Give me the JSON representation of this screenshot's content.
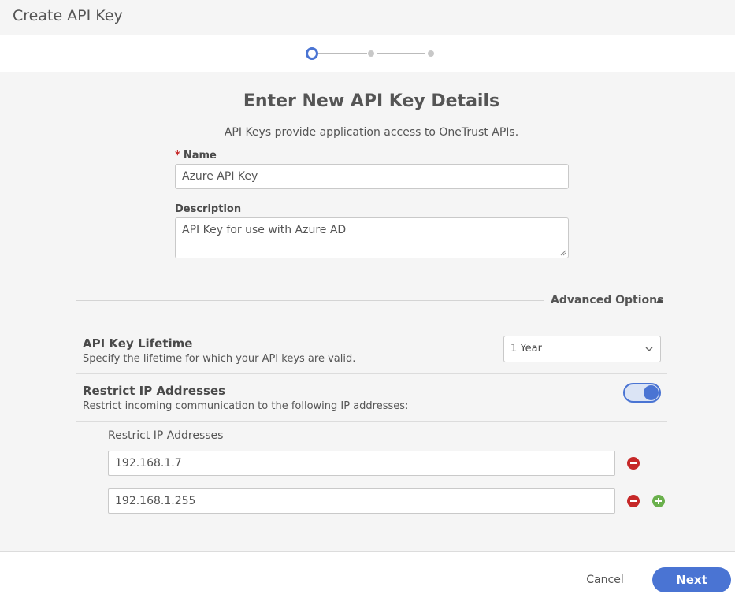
{
  "header": {
    "title": "Create API Key"
  },
  "stepper": {
    "total_steps": 3,
    "current_step": 1
  },
  "form": {
    "title": "Enter New API Key Details",
    "subtitle": "API Keys provide application access to OneTrust APIs.",
    "name": {
      "required_marker": "*",
      "label": "Name",
      "value": "Azure API Key"
    },
    "description": {
      "label": "Description",
      "value": "API Key for use with Azure AD"
    }
  },
  "advanced": {
    "toggle_label": "Advanced Options",
    "expanded": true,
    "lifetime": {
      "title": "API Key Lifetime",
      "description": "Specify the lifetime for which your API keys are valid.",
      "selected": "1 Year"
    },
    "restrict_ip": {
      "title": "Restrict IP Addresses",
      "description": "Restrict incoming communication to the following IP addresses:",
      "enabled": true,
      "list_label": "Restrict IP Addresses",
      "addresses": [
        "192.168.1.7",
        "192.168.1.255"
      ]
    }
  },
  "footer": {
    "cancel_label": "Cancel",
    "next_label": "Next"
  },
  "colors": {
    "accent": "#4a74d3",
    "remove": "#c62828",
    "add": "#6ab04c"
  }
}
